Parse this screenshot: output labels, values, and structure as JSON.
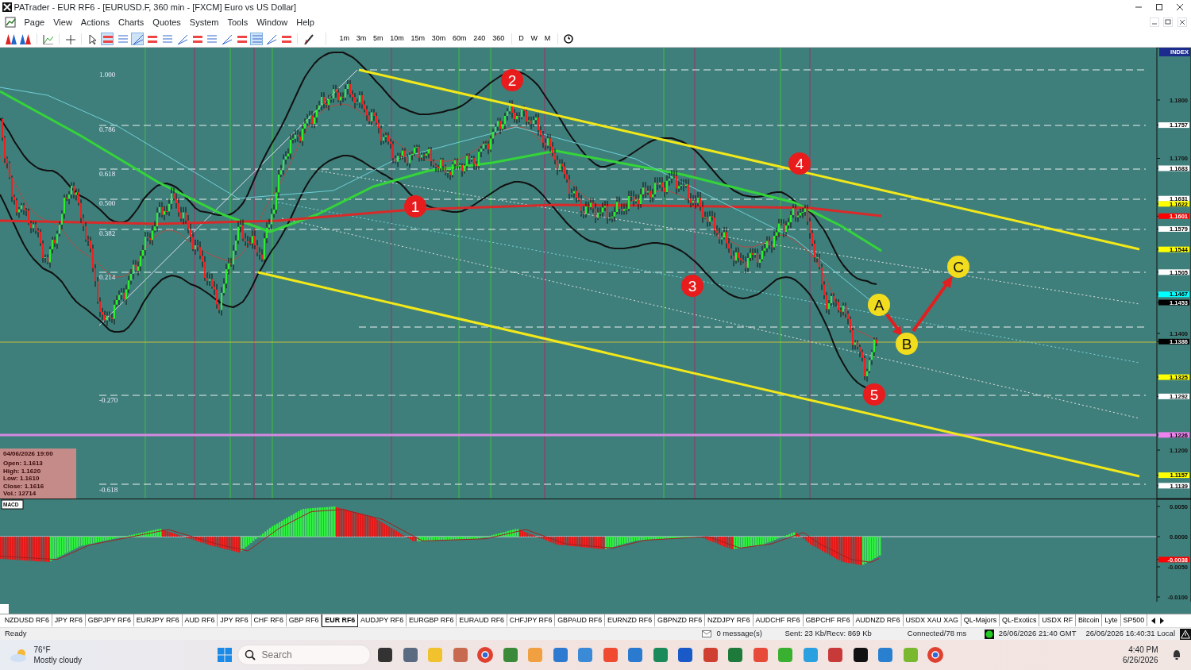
{
  "window": {
    "title": "PATrader - EUR RF6 - [EURUSD.F, 360 min - [FXCM] Euro vs US Dollar]"
  },
  "menu": [
    "Page",
    "View",
    "Actions",
    "Charts",
    "Quotes",
    "System",
    "Tools",
    "Window",
    "Help"
  ],
  "tools": [
    {
      "pressed": false
    },
    {
      "pressed": false
    },
    {
      "pressed": false
    },
    {
      "pressed": false
    },
    {
      "pressed": false
    },
    {
      "pressed": true
    },
    {
      "pressed": false
    },
    {
      "pressed": true
    },
    {
      "pressed": false
    },
    {
      "pressed": false
    },
    {
      "pressed": false
    },
    {
      "pressed": false
    },
    {
      "pressed": false
    },
    {
      "pressed": false
    },
    {
      "pressed": false
    },
    {
      "pressed": true
    },
    {
      "pressed": false
    },
    {
      "pressed": false
    },
    {
      "pressed": false
    }
  ],
  "timeframes": [
    "1m",
    "3m",
    "5m",
    "10m",
    "15m",
    "30m",
    "60m",
    "240",
    "360",
    "D",
    "W",
    "M"
  ],
  "chart": {
    "fib_levels": [
      "1.000",
      "0.786",
      "0.618",
      "0.500",
      "0.382",
      "0.214",
      "-0.270",
      "-0.618"
    ],
    "markers": [
      {
        "label": "1",
        "color": "#e81c1c"
      },
      {
        "label": "2",
        "color": "#e81c1c"
      },
      {
        "label": "3",
        "color": "#e81c1c"
      },
      {
        "label": "4",
        "color": "#e81c1c"
      },
      {
        "label": "5",
        "color": "#e81c1c"
      },
      {
        "label": "A",
        "color": "#f2dc1e"
      },
      {
        "label": "B",
        "color": "#f2dc1e"
      },
      {
        "label": "C",
        "color": "#f2dc1e"
      }
    ],
    "info_box": {
      "date": "04/06/2026 19:00",
      "lines": [
        "Open: 1.1613",
        "High: 1.1620",
        "Low: 1.1610",
        "Close: 1.1616",
        "Vol.: 12714"
      ]
    }
  },
  "price_axis": {
    "header": "INDEX",
    "labels": [
      {
        "kind": "tick",
        "text": "1.1800"
      },
      {
        "kind": "tag",
        "text": "1.1757",
        "color": "#ffffff"
      },
      {
        "kind": "tick",
        "text": "1.1700"
      },
      {
        "kind": "tag",
        "text": "1.1683",
        "color": "#ffffff"
      },
      {
        "kind": "tag",
        "text": "1.1631",
        "color": "#ffffff"
      },
      {
        "kind": "tag",
        "text": "1.1622",
        "color": "#ffff00"
      },
      {
        "kind": "tag",
        "text": "1.1601",
        "color": "#ff0000"
      },
      {
        "kind": "tag",
        "text": "1.1579",
        "color": "#ffffff"
      },
      {
        "kind": "tag",
        "text": "1.1544",
        "color": "#ffff00"
      },
      {
        "kind": "tag",
        "text": "1.1505",
        "color": "#ffffff"
      },
      {
        "kind": "tag",
        "text": "1.1467",
        "color": "#00ffff"
      },
      {
        "kind": "tag",
        "text": "1.1453",
        "color": "#000000"
      },
      {
        "kind": "tick",
        "text": "1.1400"
      },
      {
        "kind": "tag",
        "text": "1.1386",
        "color": "#000000"
      },
      {
        "kind": "tag",
        "text": "1.1325",
        "color": "#ffff00"
      },
      {
        "kind": "tag",
        "text": "1.1292",
        "color": "#ffffff"
      },
      {
        "kind": "tag",
        "text": "1.1226",
        "color": "#ee82ee"
      },
      {
        "kind": "tick",
        "text": "1.1200"
      },
      {
        "kind": "tag",
        "text": "1.1157",
        "color": "#ffff00"
      },
      {
        "kind": "tag",
        "text": "1.1139",
        "color": "#ffffff"
      }
    ]
  },
  "macd": {
    "title": "MACD",
    "labels": [
      {
        "kind": "tick",
        "text": "0.0050"
      },
      {
        "kind": "tick",
        "text": "0.0000"
      },
      {
        "kind": "tag",
        "text": "-0.0038",
        "color": "#ff0000"
      },
      {
        "kind": "tick",
        "text": "-0.0050"
      },
      {
        "kind": "tick",
        "text": "-0.0100"
      }
    ]
  },
  "symbol_tabs": [
    {
      "label": "NZDUSD RF6",
      "selected": false
    },
    {
      "label": "JPY RF6",
      "selected": false
    },
    {
      "label": "GBPJPY RF6",
      "selected": false
    },
    {
      "label": "EURJPY RF6",
      "selected": false
    },
    {
      "label": "AUD RF6",
      "selected": false
    },
    {
      "label": "JPY RF6",
      "selected": false
    },
    {
      "label": "CHF RF6",
      "selected": false
    },
    {
      "label": "GBP RF6",
      "selected": false
    },
    {
      "label": "EUR RF6",
      "selected": true
    },
    {
      "label": "AUDJPY RF6",
      "selected": false
    },
    {
      "label": "EURGBP RF6",
      "selected": false
    },
    {
      "label": "EURAUD RF6",
      "selected": false
    },
    {
      "label": "CHFJPY RF6",
      "selected": false
    },
    {
      "label": "GBPAUD RF6",
      "selected": false
    },
    {
      "label": "EURNZD RF6",
      "selected": false
    },
    {
      "label": "GBPNZD RF6",
      "selected": false
    },
    {
      "label": "NZDJPY RF6",
      "selected": false
    },
    {
      "label": "AUDCHF RF6",
      "selected": false
    },
    {
      "label": "GBPCHF RF6",
      "selected": false
    },
    {
      "label": "AUDNZD RF6",
      "selected": false
    },
    {
      "label": "USDX XAU XAG",
      "selected": false
    },
    {
      "label": "QL-Majors",
      "selected": false
    },
    {
      "label": "QL-Exotics",
      "selected": false
    },
    {
      "label": "USDX RF",
      "selected": false
    },
    {
      "label": "Bitcoin",
      "selected": false
    },
    {
      "label": "Lyte",
      "selected": false
    },
    {
      "label": "SP500",
      "selected": false
    }
  ],
  "status_bar": {
    "state": "Ready",
    "messages": "0 message(s)",
    "traffic": "Sent: 23 Kb/Recv: 869 Kb",
    "connection": "Connected/78 ms",
    "gmt_time": "26/06/2026 21:40 GMT",
    "local_time": "26/06/2026 16:40:31 Local"
  },
  "taskbar": {
    "temperature": "76°F",
    "weather": "Mostly cloudy",
    "search": {
      "placeholder": "Search"
    },
    "time": "4:40 PM",
    "date": "6/26/2026"
  }
}
